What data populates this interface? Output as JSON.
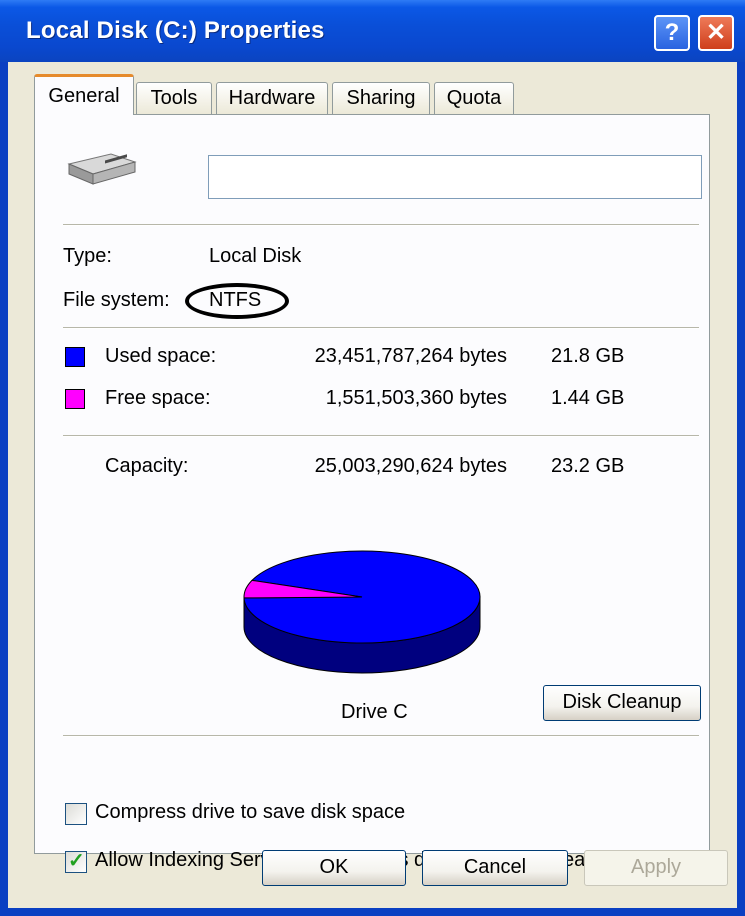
{
  "window": {
    "title": "Local Disk (C:) Properties",
    "help_label": "?",
    "close_label": "✕"
  },
  "tabs": [
    {
      "label": "General",
      "active": true
    },
    {
      "label": "Tools"
    },
    {
      "label": "Hardware"
    },
    {
      "label": "Sharing"
    },
    {
      "label": "Quota"
    }
  ],
  "general": {
    "drive_icon": "hard-drive-icon",
    "name_value": "",
    "type_label": "Type:",
    "type_value": "Local Disk",
    "fs_label": "File system:",
    "fs_value": "NTFS",
    "used_label": "Used space:",
    "used_bytes": "23,451,787,264 bytes",
    "used_gb": "21.8 GB",
    "used_color": "#0000ff",
    "free_label": "Free space:",
    "free_bytes": "1,551,503,360 bytes",
    "free_gb": "1.44 GB",
    "free_color": "#ff00ff",
    "capacity_label": "Capacity:",
    "capacity_bytes": "25,003,290,624 bytes",
    "capacity_gb": "23.2 GB",
    "drive_caption": "Drive C",
    "cleanup_label": "Disk Cleanup"
  },
  "pie_data": {
    "used_bytes": 23451787264,
    "free_bytes": 1551503360
  },
  "options": {
    "compress_label": "Compress drive to save disk space",
    "compress_checked": false,
    "index_label": "Allow Indexing Service to index this disk for fast file searching",
    "index_checked": true
  },
  "buttons": {
    "ok": "OK",
    "cancel": "Cancel",
    "apply": "Apply"
  }
}
